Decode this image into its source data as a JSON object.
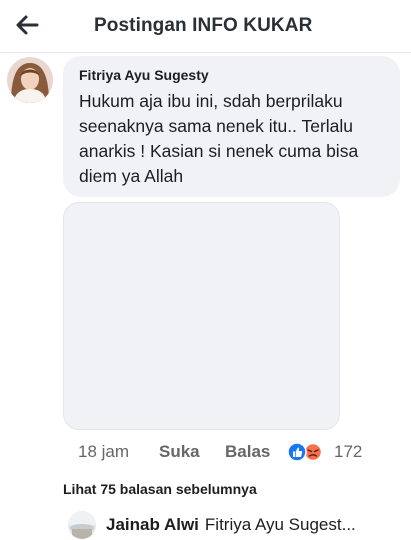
{
  "header": {
    "title": "Postingan INFO KUKAR",
    "back_icon": "arrow-left-icon"
  },
  "comment": {
    "author": "Fitriya Ayu Sugesty",
    "text": "Hukum aja ibu ini, sdah berprilaku seenaknya sama nenek itu.. Terlalu anarkis ! Kasian si nenek cuma bisa diem ya Allah",
    "time": "18 jam",
    "like_label": "Suka",
    "reply_label": "Balas",
    "reaction_count": "172",
    "reaction_icons": [
      "like-reaction-icon",
      "angry-reaction-icon"
    ]
  },
  "replies": {
    "more_label": "Lihat 75 balasan sebelumnya",
    "preview_author": "Jainab Alwi",
    "preview_text": "Fitriya Ayu Sugest..."
  },
  "colors": {
    "bubble": "#f0f2f5",
    "secondary_text": "#65676b",
    "like_blue": "#1877f2",
    "angry_orange": "#f7714c"
  }
}
